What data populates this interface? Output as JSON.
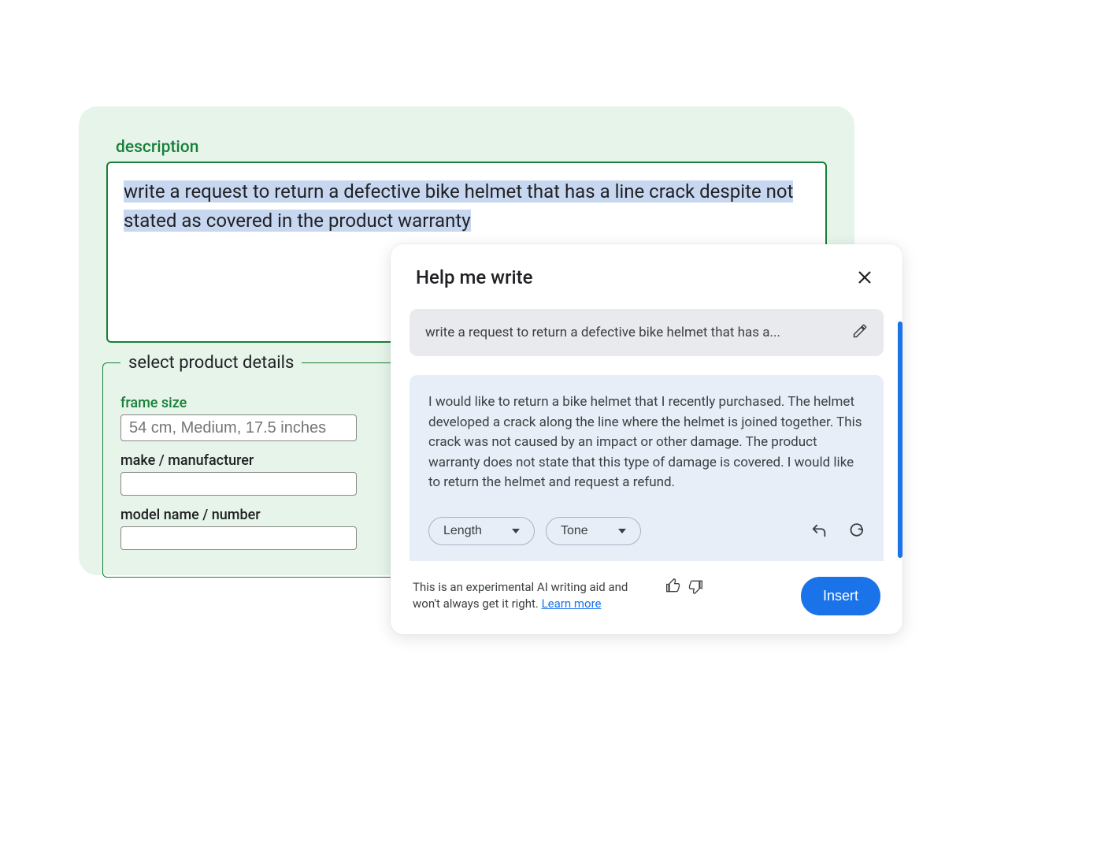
{
  "form": {
    "description_label": "description",
    "description_text": "write a request to return a defective bike helmet that has a line crack despite not stated as covered in the product warranty",
    "fieldset_legend": "select product details",
    "frame_size_label": "frame size",
    "frame_size_placeholder": "54 cm, Medium, 17.5 inches",
    "make_label": "make / manufacturer",
    "model_label": "model name / number"
  },
  "help": {
    "title": "Help me write",
    "prompt_text": "write a request to return a defective bike helmet that has a...",
    "response_text": "I would like to return a bike helmet that I recently purchased. The helmet developed a crack along the line where the helmet is joined together. This crack was not caused by an impact or other damage. The product warranty does not state that this type of damage is covered. I would like to return the helmet and request a refund.",
    "length_label": "Length",
    "tone_label": "Tone",
    "footer_text": "This is an experimental AI writing aid and won't always get it right. ",
    "learn_more": "Learn more",
    "insert_label": "Insert"
  }
}
